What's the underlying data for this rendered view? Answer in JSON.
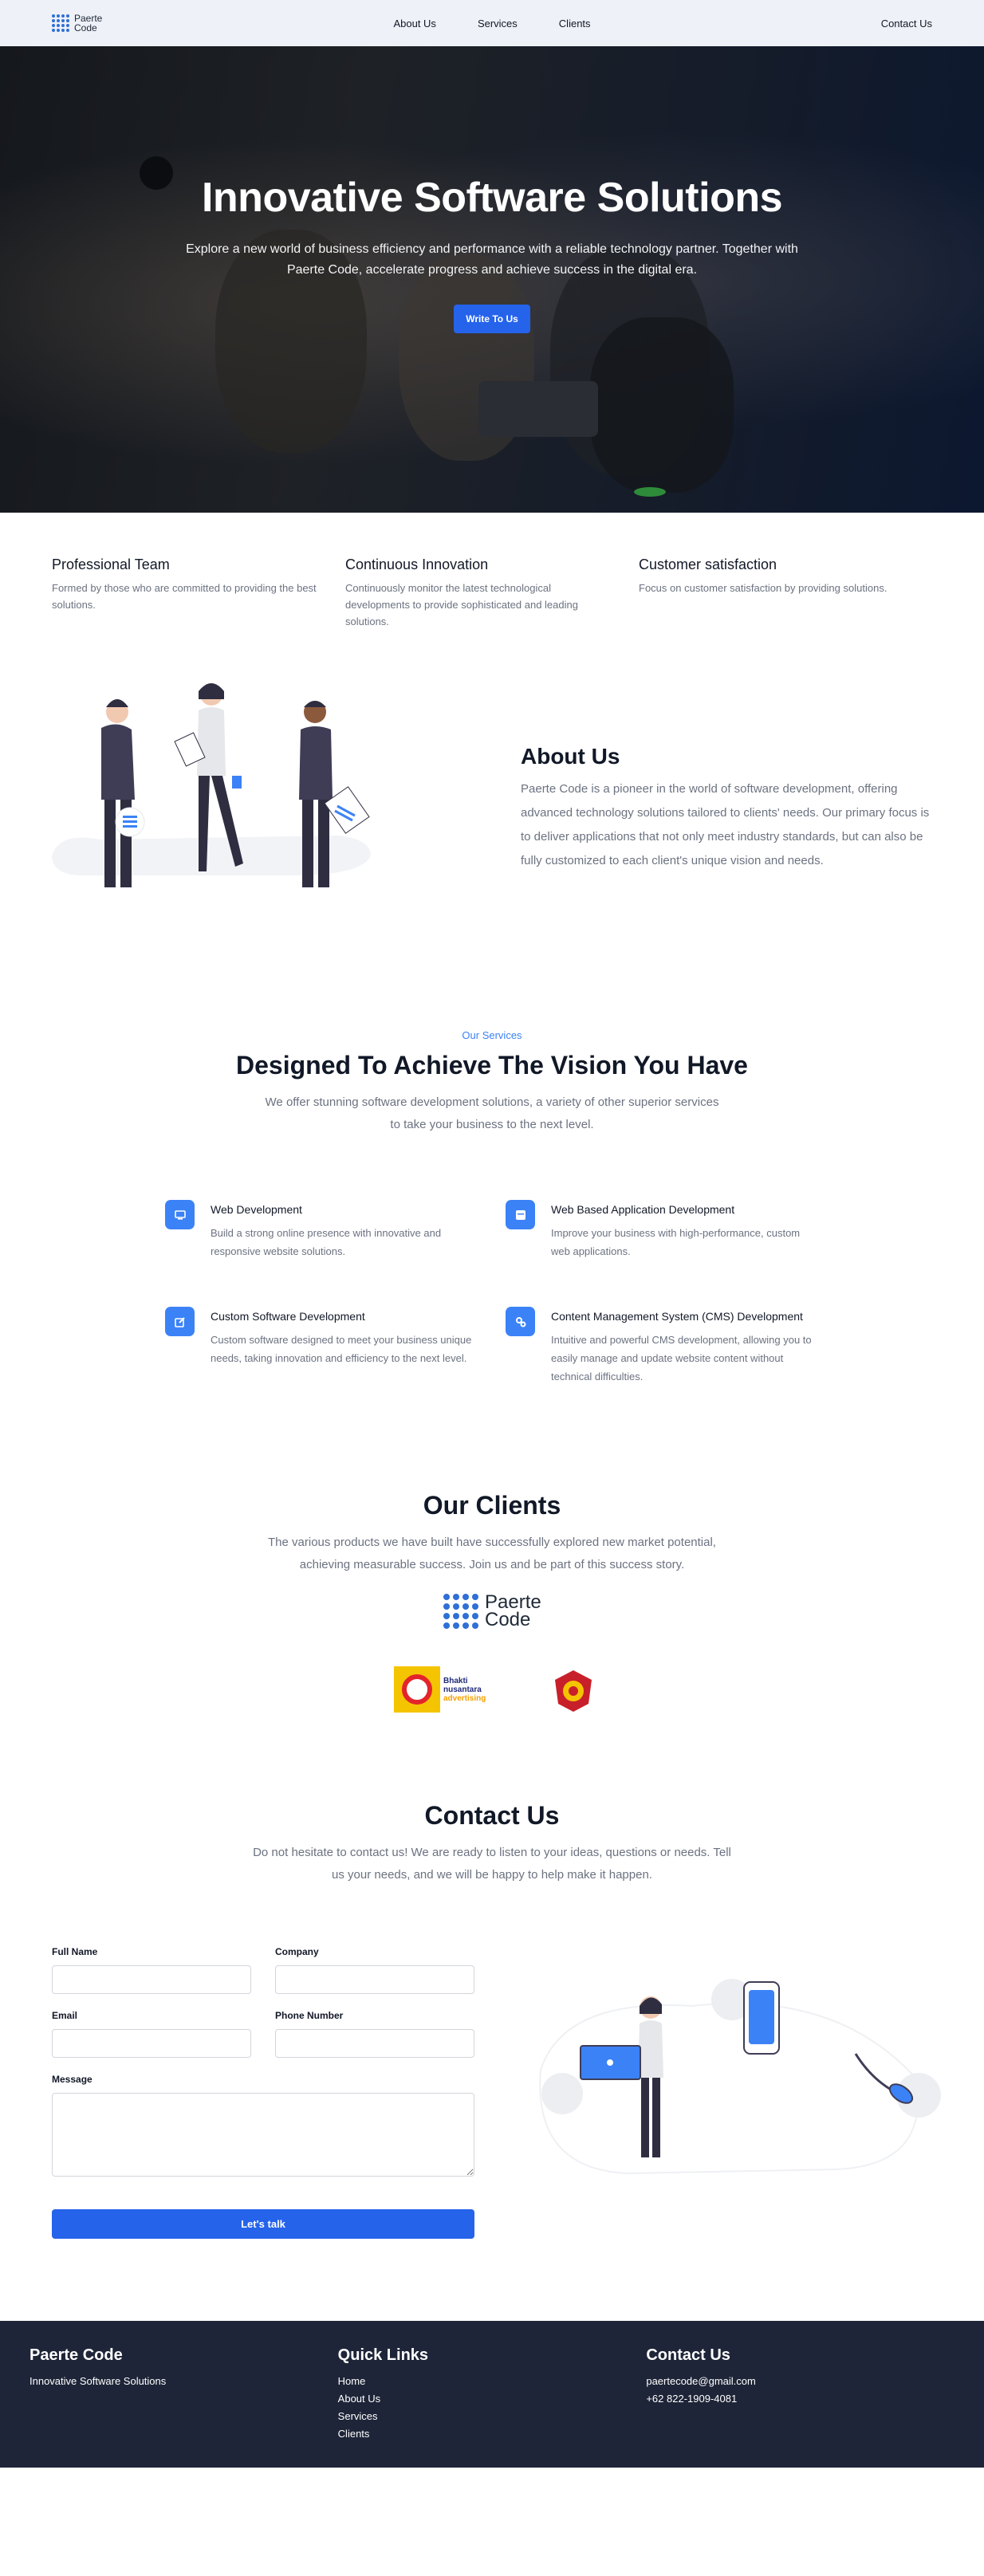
{
  "brand": {
    "line1": "Paerte",
    "line2": "Code"
  },
  "nav": {
    "links": [
      "About Us",
      "Services",
      "Clients"
    ],
    "contact": "Contact Us"
  },
  "hero": {
    "title": "Innovative Software Solutions",
    "subtitle": "Explore a new world of business efficiency and performance with a reliable technology partner. Together with Paerte Code, accelerate progress and achieve success in the digital era.",
    "cta": "Write To Us"
  },
  "features": [
    {
      "title": "Professional Team",
      "text": "Formed by those who are committed to providing the best solutions."
    },
    {
      "title": "Continuous Innovation",
      "text": "Continuously monitor the latest technological developments to provide sophisticated and leading solutions."
    },
    {
      "title": "Customer satisfaction",
      "text": "Focus on customer satisfaction by providing solutions."
    }
  ],
  "about": {
    "title": "About Us",
    "text": "Paerte Code is a pioneer in the world of software development, offering advanced technology solutions tailored to clients' needs. Our primary focus is to deliver applications that not only meet industry standards, but can also be fully customized to each client's unique vision and needs."
  },
  "services": {
    "eyebrow": "Our Services",
    "title": "Designed To Achieve The Vision You Have",
    "subtitle": "We offer stunning software development solutions, a variety of other superior services to take your business to the next level.",
    "items": [
      {
        "title": "Web Development",
        "text": "Build a strong online presence with innovative and responsive website solutions.",
        "icon": "monitor-icon"
      },
      {
        "title": "Web Based Application Development",
        "text": "Improve your business with high-performance, custom web applications.",
        "icon": "app-window-icon"
      },
      {
        "title": "Custom Software Development",
        "text": "Custom software designed to meet your business unique needs, taking innovation and efficiency to the next level.",
        "icon": "edit-icon"
      },
      {
        "title": "Content Management System (CMS) Development",
        "text": "Intuitive and powerful CMS development, allowing you to easily manage and update website content without technical difficulties.",
        "icon": "gears-icon"
      }
    ]
  },
  "clients": {
    "title": "Our Clients",
    "subtitle": "The various products we have built have successfully explored new market potential, achieving measurable success. Join us and be part of this success story.",
    "logos": [
      {
        "name": "Paerte Code",
        "line1": "Paerte",
        "line2": "Code"
      },
      {
        "name": "Bhakti nusantara advertising",
        "line1": "Bhakti",
        "line2": "nusantara",
        "line3": "advertising"
      },
      {
        "name": "red-emblem"
      }
    ]
  },
  "contact": {
    "title": "Contact Us",
    "subtitle": "Do not hesitate to contact us! We are ready to listen to your ideas, questions or needs. Tell us your needs, and we will be happy to help make it happen.",
    "fields": {
      "full_name": "Full Name",
      "company": "Company",
      "email": "Email",
      "phone": "Phone Number",
      "message": "Message"
    },
    "submit": "Let's talk"
  },
  "footer": {
    "brand_title": "Paerte Code",
    "brand_tagline": "Innovative Software Solutions",
    "links_title": "Quick Links",
    "links": [
      "Home",
      "About Us",
      "Services",
      "Clients"
    ],
    "contact_title": "Contact Us",
    "email": "paertecode@gmail.com",
    "phone": "+62 822-1909-4081"
  },
  "colors": {
    "primary": "#2563eb",
    "accent": "#3b82f6",
    "footer_bg": "#1e2538",
    "nav_bg": "#eef1f7"
  }
}
